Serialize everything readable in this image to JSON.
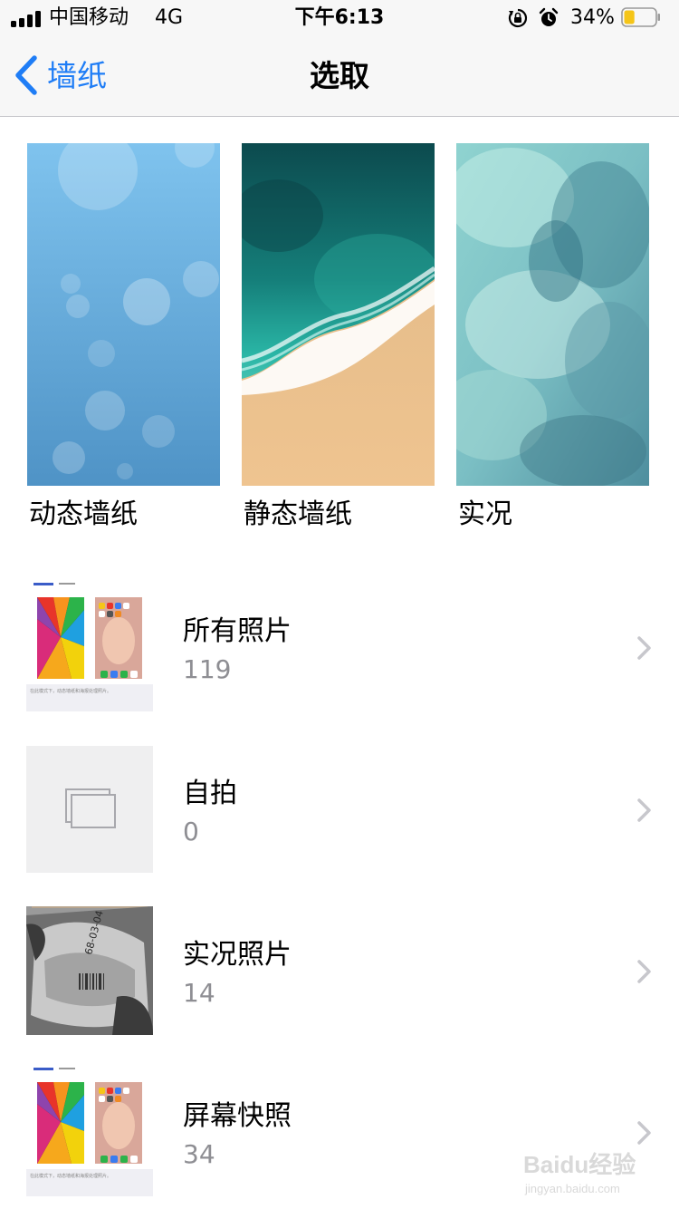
{
  "status_bar": {
    "carrier": "中国移动",
    "network": "4G",
    "time": "下午6:13",
    "battery_percent": "34%",
    "battery_level": 0.34,
    "icons": [
      "signal-icon",
      "rotation-lock-icon",
      "alarm-icon",
      "battery-icon"
    ]
  },
  "nav": {
    "back_label": "墙纸",
    "title": "选取"
  },
  "wallpapers": [
    {
      "label": "动态墙纸"
    },
    {
      "label": "静态墙纸"
    },
    {
      "label": "实况"
    }
  ],
  "albums": [
    {
      "name": "所有照片",
      "count": "119",
      "thumb_caption": "在此模式下，动态墙纸和海报处理照片。"
    },
    {
      "name": "自拍",
      "count": "0"
    },
    {
      "name": "实况照片",
      "count": "14",
      "thumb_text": "68-03-04"
    },
    {
      "name": "屏幕快照",
      "count": "34",
      "thumb_caption": "在此模式下，动态墙纸和海报处理照片。"
    }
  ],
  "watermark": {
    "brand": "Baidu经验",
    "url": "jingyan.baidu.com"
  },
  "colors": {
    "accent": "#1f7df6",
    "bar_background": "#f7f7f7",
    "secondary_text": "#8e8e93",
    "chevron": "#c7c7cc",
    "battery_fill": "#f5c518"
  }
}
